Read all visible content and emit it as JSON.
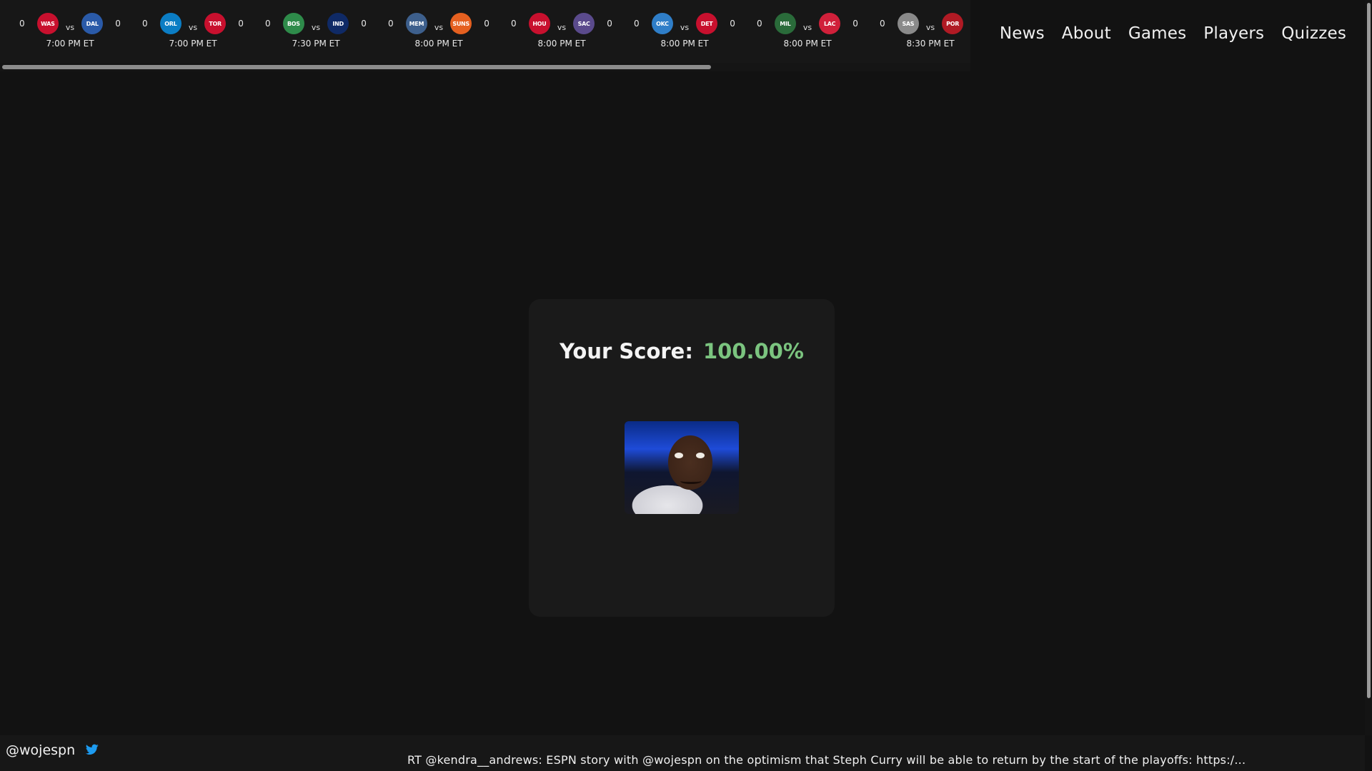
{
  "ticker": {
    "games": [
      {
        "away": {
          "abbr": "WAS",
          "score": "0",
          "color": "#c8102e"
        },
        "home": {
          "abbr": "DAL",
          "score": "0",
          "color": "#2a5aa8"
        },
        "vs": "vs",
        "time": "7:00 PM ET"
      },
      {
        "away": {
          "abbr": "ORL",
          "score": "0",
          "color": "#0b7dc4"
        },
        "home": {
          "abbr": "TOR",
          "score": "0",
          "color": "#c8102e"
        },
        "vs": "vs",
        "time": "7:00 PM ET"
      },
      {
        "away": {
          "abbr": "BOS",
          "score": "0",
          "color": "#2e8b4a"
        },
        "home": {
          "abbr": "IND",
          "score": "0",
          "color": "#0f2a66"
        },
        "vs": "vs",
        "time": "7:30 PM ET"
      },
      {
        "away": {
          "abbr": "MEM",
          "score": "0",
          "color": "#3d5f8c"
        },
        "home": {
          "abbr": "SUNS",
          "score": "0",
          "color": "#e56020"
        },
        "vs": "vs",
        "time": "8:00 PM ET"
      },
      {
        "away": {
          "abbr": "HOU",
          "score": "0",
          "color": "#c8102e"
        },
        "home": {
          "abbr": "SAC",
          "score": "0",
          "color": "#5a4a8c"
        },
        "vs": "vs",
        "time": "8:00 PM ET"
      },
      {
        "away": {
          "abbr": "OKC",
          "score": "0",
          "color": "#2f7ec8"
        },
        "home": {
          "abbr": "DET",
          "score": "0",
          "color": "#c8102e"
        },
        "vs": "vs",
        "time": "8:00 PM ET"
      },
      {
        "away": {
          "abbr": "MIL",
          "score": "0",
          "color": "#2a6b3a"
        },
        "home": {
          "abbr": "LAC",
          "score": "0",
          "color": "#d0203a"
        },
        "vs": "vs",
        "time": "8:00 PM ET"
      },
      {
        "away": {
          "abbr": "SAS",
          "score": "0",
          "color": "#8a8a8a"
        },
        "home": {
          "abbr": "POR",
          "score": "0",
          "color": "#b01a24"
        },
        "vs": "vs",
        "time": "8:30 PM ET"
      }
    ]
  },
  "nav": {
    "items": [
      {
        "label": "News"
      },
      {
        "label": "About"
      },
      {
        "label": "Games"
      },
      {
        "label": "Players"
      },
      {
        "label": "Quizzes"
      }
    ]
  },
  "result": {
    "score_label": "Your Score:",
    "score_value": "100.00%",
    "score_color": "#7bc47f"
  },
  "footer": {
    "handle": "@wojespn",
    "icon": "twitter-icon",
    "tweet": "RT @kendra__andrews: ESPN story with @wojespn on the optimism that Steph Curry will be able to return by the start of the playoffs: https:/..."
  }
}
